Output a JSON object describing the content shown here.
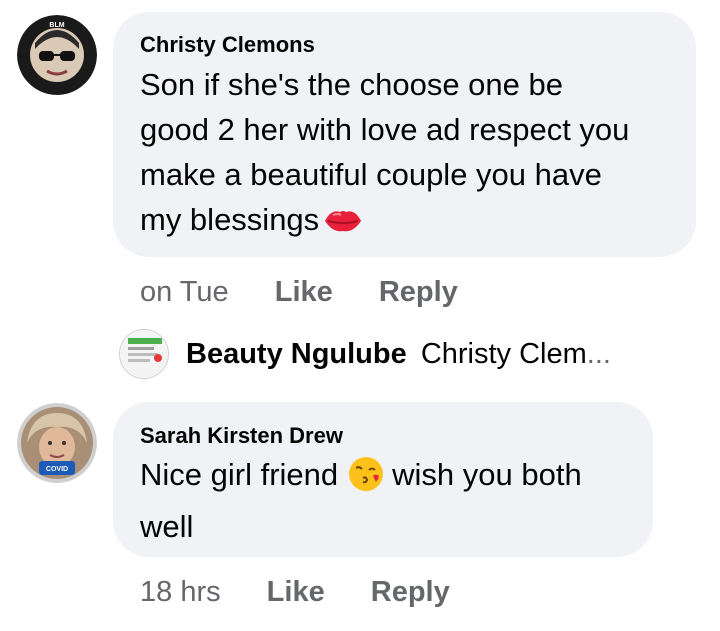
{
  "comments": [
    {
      "author": "Christy Clemons",
      "text_lines": [
        "Son if she's the choose one be",
        "good 2 her with love ad respect you",
        "make a beautiful couple you have",
        "my blessings"
      ],
      "emoji": "kiss-mark-icon",
      "avatar_badge": "BLACK LIVES MATTER",
      "time": "on Tue",
      "like_label": "Like",
      "reply_label": "Reply"
    },
    {
      "author": "Sarah Kirsten Drew",
      "text_line1_before": "Nice girl friend",
      "text_line1_after": "wish you both",
      "text_line2": "well",
      "emoji": "face-blowing-kiss-icon",
      "time": "18 hrs",
      "like_label": "Like",
      "reply_label": "Reply"
    }
  ],
  "reply_preview": {
    "author": "Beauty Ngulube",
    "text": "Christy Clem",
    "ellipsis": "..."
  },
  "colors": {
    "bubble": "#f0f2f5",
    "text": "#050505",
    "secondary": "#65676b",
    "kiss": "#e8203a"
  }
}
